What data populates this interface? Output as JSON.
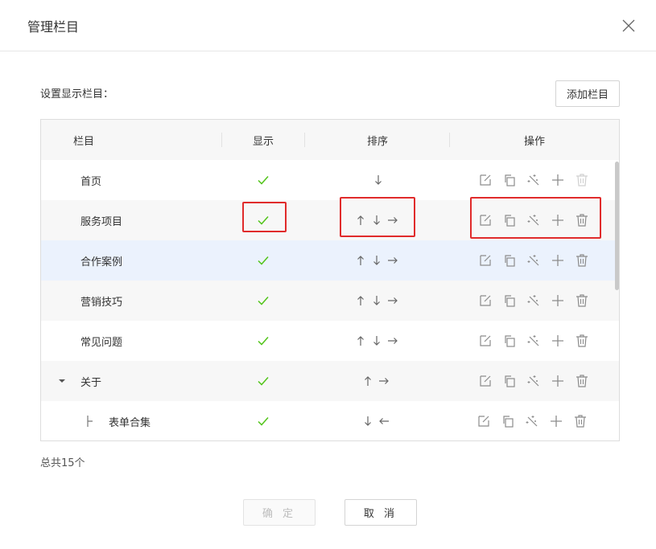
{
  "dialog": {
    "title": "管理栏目",
    "section_label": "设置显示栏目：",
    "add_button": "添加栏目",
    "total": "总共15个",
    "confirm_button": "确 定",
    "cancel_button": "取 消"
  },
  "table": {
    "headers": {
      "name": "栏目",
      "show": "显示",
      "sort": "排序",
      "ops": "操作"
    },
    "rows": [
      {
        "name": "首页",
        "visible": true,
        "sort": [
          "down"
        ],
        "level": 0
      },
      {
        "name": "服务项目",
        "visible": true,
        "sort": [
          "up",
          "down",
          "right"
        ],
        "level": 0
      },
      {
        "name": "合作案例",
        "visible": true,
        "sort": [
          "up",
          "down",
          "right"
        ],
        "level": 0,
        "selected": true
      },
      {
        "name": "营销技巧",
        "visible": true,
        "sort": [
          "up",
          "down",
          "right"
        ],
        "level": 0
      },
      {
        "name": "常见问题",
        "visible": true,
        "sort": [
          "up",
          "down",
          "right"
        ],
        "level": 0
      },
      {
        "name": "关于",
        "visible": true,
        "sort": [
          "up",
          "right"
        ],
        "level": 0,
        "expanded": true
      },
      {
        "name": "表单合集",
        "visible": true,
        "sort": [
          "down",
          "left"
        ],
        "level": 1
      }
    ],
    "operation_icons": [
      "edit-icon",
      "copy-icon",
      "wand-icon",
      "plus-icon",
      "trash-icon"
    ]
  },
  "colors": {
    "check": "#52c41a",
    "highlight": "#e02b2b",
    "selected_row": "#ebf2fd",
    "icon": "#8c8c8c",
    "icon_disabled": "#d0d0d0"
  }
}
